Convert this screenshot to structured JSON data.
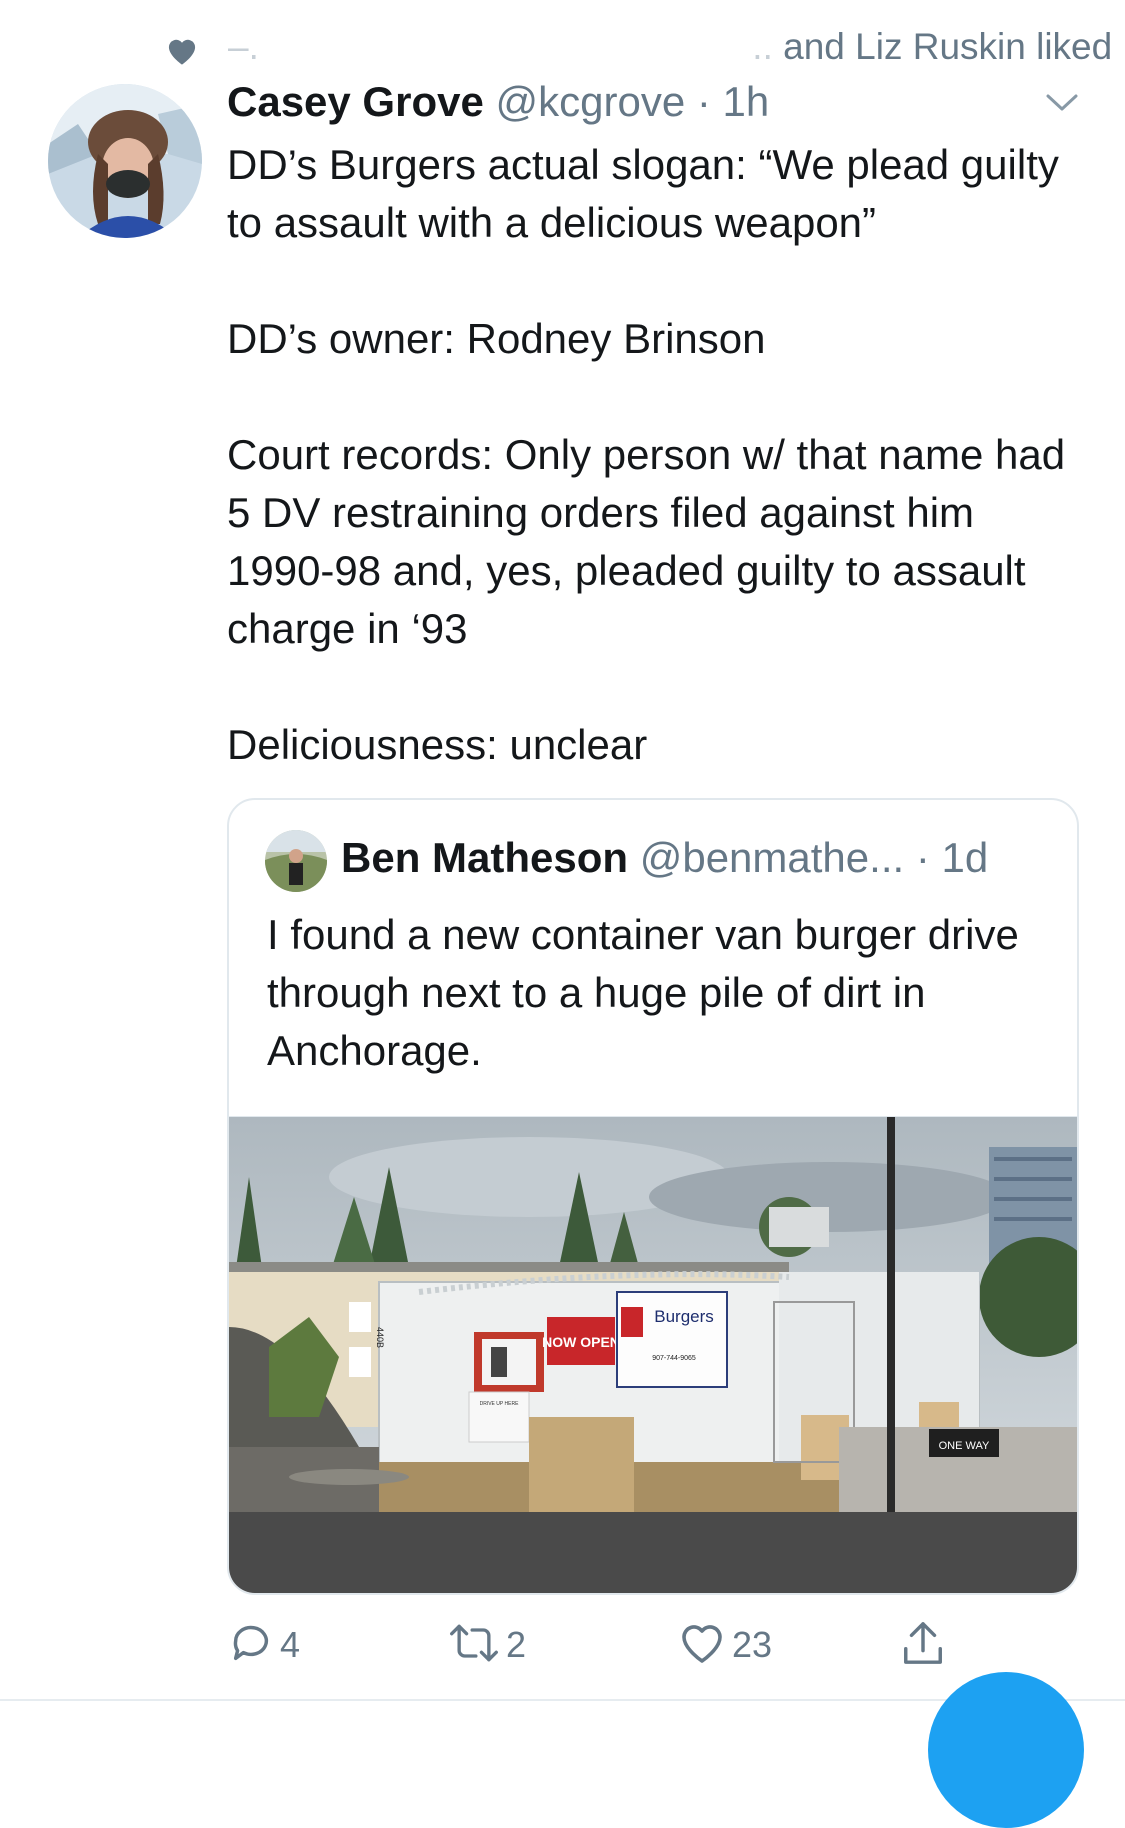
{
  "social_context": {
    "text": "and Liz Ruskin liked",
    "icon": "heart-icon"
  },
  "tweet": {
    "author_name": "Casey Grove",
    "author_handle": "@kcgrove",
    "separator": "·",
    "time": "1h",
    "lines": [
      "DD’s Burgers actual slogan: “We plead guilty to assault with a delicious weapon”",
      "DD’s owner: Rodney Brinson",
      "Court records: Only person w/ that name had 5 DV restraining orders filed against him 1990-98 and, yes, pleaded guilty to assault charge in ‘93",
      "Deliciousness: unclear"
    ]
  },
  "quoted_tweet": {
    "author_name": "Ben Matheson",
    "author_handle": "@benmathe...",
    "separator": "·",
    "time": "1d",
    "text": "I found a new container van burger drive through next to a huge pile of dirt in Anchorage.",
    "photo": {
      "now_open_sign": "NOW OPEN",
      "brand_sign": "Burgers",
      "phone": "907-744-9065",
      "drive_sign": "DRIVE UP HERE",
      "one_way_sign": "ONE WAY",
      "address": "440B"
    }
  },
  "actions": {
    "replies": "4",
    "retweets": "2",
    "likes": "23"
  },
  "colors": {
    "text": "#14171a",
    "secondary": "#657786",
    "border": "#e1e8ed",
    "accent": "#1da1f2"
  }
}
